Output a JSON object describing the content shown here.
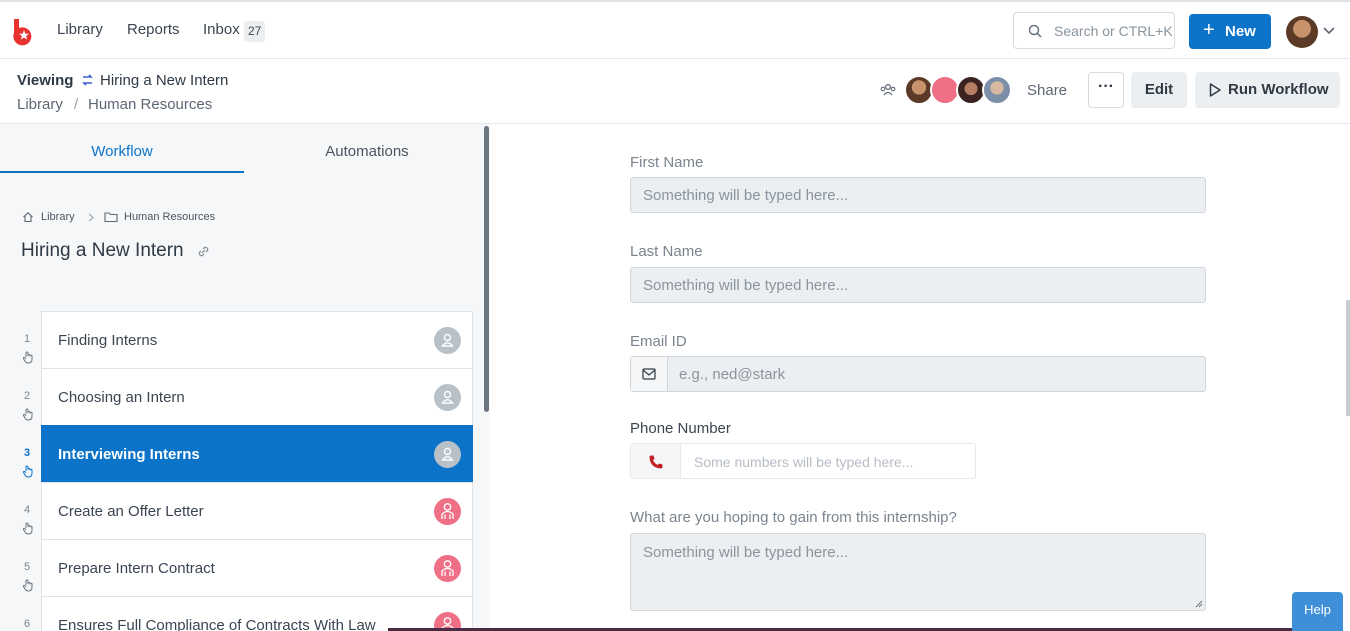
{
  "nav": {
    "links": [
      "Library",
      "Reports",
      "Inbox"
    ],
    "inbox_count": "27",
    "search_placeholder": "Search or CTRL+K",
    "new_label": "New"
  },
  "header": {
    "viewing_label": "Viewing",
    "workflow_title": "Hiring a New Intern",
    "breadcrumb": [
      "Library",
      "Human Resources"
    ],
    "breadcrumb_sep": "/",
    "share_label": "Share",
    "more_label": "···",
    "edit_label": "Edit",
    "run_label": "Run Workflow"
  },
  "panel": {
    "tabs": [
      "Workflow",
      "Automations"
    ],
    "breadcrumb": [
      "Library",
      "Human Resources"
    ],
    "title": "Hiring a New Intern",
    "steps": [
      {
        "num": "1",
        "label": "Finding Interns",
        "avatar": "grey"
      },
      {
        "num": "2",
        "label": "Choosing an Intern",
        "avatar": "grey"
      },
      {
        "num": "3",
        "label": "Interviewing Interns",
        "avatar": "grey",
        "active": true
      },
      {
        "num": "4",
        "label": "Create an Offer Letter",
        "avatar": "pink"
      },
      {
        "num": "5",
        "label": "Prepare Intern Contract",
        "avatar": "pink"
      },
      {
        "num": "6",
        "label": "Ensures Full Compliance of Contracts With Law",
        "avatar": "pink"
      }
    ]
  },
  "form": {
    "first_name": {
      "label": "First Name",
      "placeholder": "Something will be typed here..."
    },
    "last_name": {
      "label": "Last Name",
      "placeholder": "Something will be typed here..."
    },
    "email": {
      "label": "Email ID",
      "placeholder": "e.g., ned@stark"
    },
    "phone": {
      "label": "Phone Number",
      "placeholder": "Some numbers will be typed here..."
    },
    "hope": {
      "label": "What are you hoping to gain from this internship?",
      "placeholder": "Something will be typed here..."
    }
  },
  "help_label": "Help",
  "colors": {
    "accent": "#0c74c8",
    "logo": "#e8322f",
    "assignee_pink": "#ef6f86"
  }
}
